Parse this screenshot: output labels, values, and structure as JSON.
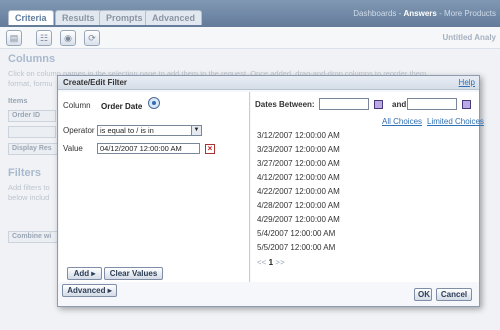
{
  "tabs": [
    {
      "label": "Criteria"
    },
    {
      "label": "Results"
    },
    {
      "label": "Prompts"
    },
    {
      "label": "Advanced"
    }
  ],
  "top_links": {
    "dashboards": "Dashboards",
    "sep1": " - ",
    "answers": "Answers",
    "sep2": " - ",
    "more": "More Products"
  },
  "toolbar": {
    "untitled": "Untitled Analy"
  },
  "background": {
    "columns_heading": "Columns",
    "columns_text1": "Click on column names in the selection pane to add them to the request. Once added, drag-and-drop columns to reorder them,",
    "columns_text2": "format, formu",
    "items_label": "Items",
    "order_id": "Order ID",
    "display_results": "Display Res",
    "filters_heading": "Filters",
    "filters_text1": "Add filters to",
    "filters_text2": "below includ",
    "combine": "Combine wi"
  },
  "dialog": {
    "title": "Create/Edit Filter",
    "help": "Help",
    "column_label": "Column",
    "column_name": "Order Date",
    "operator_label": "Operator",
    "operator_value": "is equal to / is in",
    "value_label": "Value",
    "value_input": "04/12/2007 12:00:00 AM",
    "add_button": "Add",
    "clear_button": "Clear Values",
    "advanced_button": "Advanced",
    "ok_button": "OK",
    "cancel_button": "Cancel",
    "dates_between": "Dates Between:",
    "and_label": "and",
    "all_choices": "All Choices",
    "limited_choices": "Limited Choices",
    "dates": [
      "3/12/2007 12:00:00 AM",
      "3/23/2007 12:00:00 AM",
      "3/27/2007 12:00:00 AM",
      "4/12/2007 12:00:00 AM",
      "4/22/2007 12:00:00 AM",
      "4/28/2007 12:00:00 AM",
      "4/29/2007 12:00:00 AM",
      "5/4/2007 12:00:00 AM",
      "5/5/2007 12:00:00 AM"
    ],
    "pager": {
      "prev": "<<",
      "current": "1",
      "next": ">>"
    }
  }
}
